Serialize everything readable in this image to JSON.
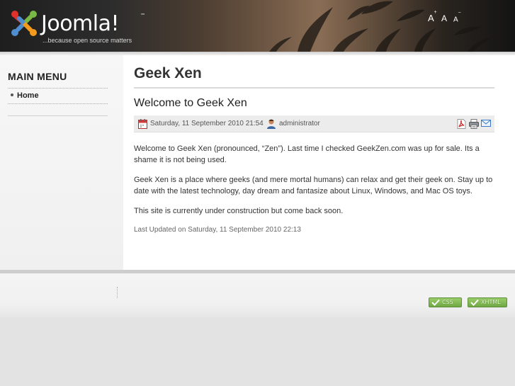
{
  "header": {
    "brand": "Joomla!",
    "tagline": "...because open source matters",
    "font_tools": {
      "increase": "A",
      "reset": "A",
      "decrease": "A"
    }
  },
  "sidebar": {
    "title": "MAIN MENU",
    "items": [
      {
        "label": "Home"
      }
    ]
  },
  "main": {
    "site_title": "Geek Xen",
    "article": {
      "title": "Welcome to Geek Xen",
      "date": "Saturday, 11 September 2010 21:54",
      "author": "administrator",
      "paragraphs": [
        "Welcome to Geek Xen (pronounced, “Zen”). Last time I checked GeekZen.com was up for sale. Its a shame it is not being used.",
        "Geek Xen is a place where geeks (and mere mortal humans) can relax and get their geek on. Stay up to date with the latest technology, day dream and fantasize about Linux, Windows, and Mac OS toys.",
        "This site is currently under construction but come back soon."
      ],
      "last_updated": "Last Updated on Saturday, 11 September 2010 22:13"
    }
  },
  "footer": {
    "badges": [
      {
        "label": "CSS"
      },
      {
        "label": "XHTML"
      }
    ]
  },
  "colors": {
    "badge_green": "#7cb44f",
    "pdf_red": "#c8282a",
    "email_blue": "#3a79c4",
    "logo_red": "#e2312c",
    "logo_green": "#7ab846",
    "logo_orange": "#f39a1f",
    "logo_blue": "#4f8fd0"
  },
  "icons": [
    "calendar-icon",
    "user-icon",
    "pdf-icon",
    "print-icon",
    "email-icon",
    "check-icon",
    "joomla-logo-icon"
  ]
}
